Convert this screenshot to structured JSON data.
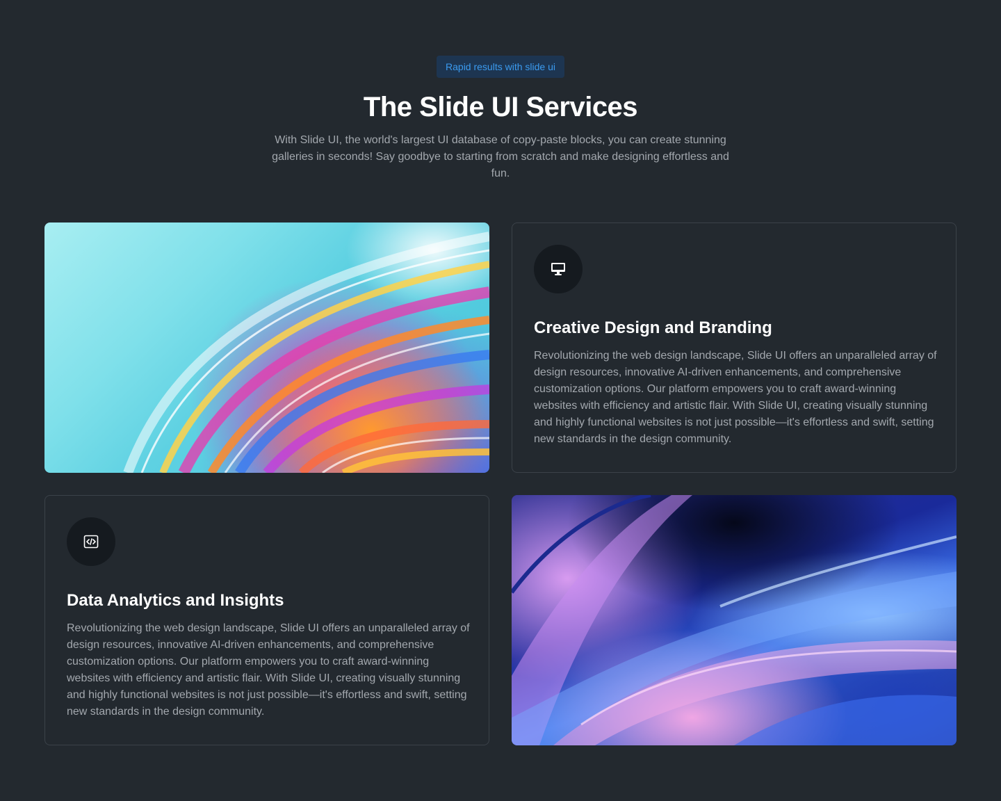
{
  "header": {
    "badge": "Rapid results with slide ui",
    "title": "The Slide UI Services",
    "subtitle": "With Slide UI, the world's largest UI database of copy-paste blocks, you can create stunning galleries in seconds! Say goodbye to starting from scratch and make designing effortless and fun."
  },
  "services": [
    {
      "icon": "monitor-icon",
      "title": "Creative Design and Branding",
      "description": "Revolutionizing the web design landscape, Slide UI offers an unparalleled array of design resources, innovative AI-driven enhancements, and comprehensive customization options. Our platform empowers you to craft award-winning websites with efficiency and artistic flair. With Slide UI, creating visually stunning and highly functional websites is not just possible—it's effortless and swift, setting new standards in the design community."
    },
    {
      "icon": "code-icon",
      "title": "Data Analytics and Insights",
      "description": "Revolutionizing the web design landscape, Slide UI offers an unparalleled array of design resources, innovative AI-driven enhancements, and comprehensive customization options. Our platform empowers you to craft award-winning websites with efficiency and artistic flair. With Slide UI, creating visually stunning and highly functional websites is not just possible—it's effortless and swift, setting new standards in the design community."
    }
  ],
  "colors": {
    "background": "#23292f",
    "badge_bg": "#1d3551",
    "badge_text": "#3b9bf0",
    "card_border": "#3b4249",
    "icon_circle": "#151a1f",
    "muted_text": "#a3a8ae"
  }
}
